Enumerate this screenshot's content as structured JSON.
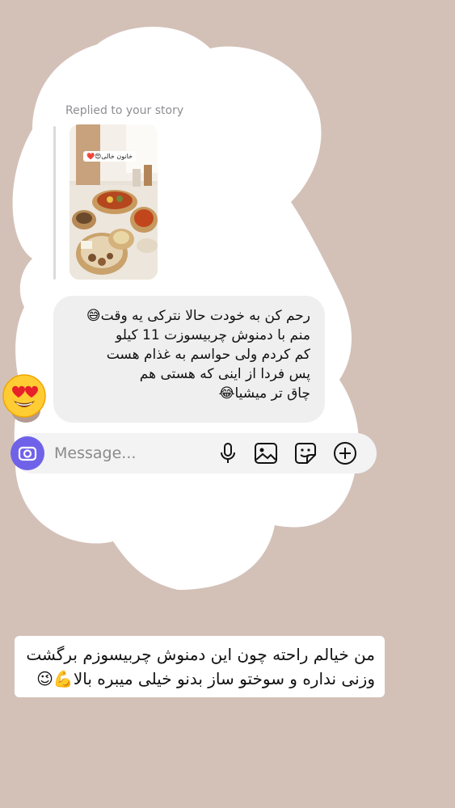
{
  "story_reply": {
    "label": "Replied to your story",
    "thumbnail_tag": "خانون خالی😍❤️"
  },
  "message": {
    "lines": [
      "رحم کن به خودت حالا نترکی یه وقت😅",
      "منم با دمنوش چربیسوزت 11 کیلو",
      "کم کردم ولی حواسم به غذام هست",
      "پس فردا از اینی که هستی هم",
      "چاق تر میشیا😂"
    ],
    "reaction_emoji": "heart-eyes-face"
  },
  "composer": {
    "placeholder": "Message...",
    "icons": [
      "camera-icon",
      "microphone-icon",
      "gallery-icon",
      "sticker-icon",
      "add-icon"
    ]
  },
  "caption": {
    "lines": [
      "من خیالم راحته چون این دمنوش چربیسوزم برگشت",
      "وزنی نداره و  سوختو ساز بدنو خیلی میبره بالا💪😉"
    ]
  },
  "colors": {
    "background": "#d3c1b8",
    "camera_button": "#6f62e8",
    "bubble": "#efefef"
  }
}
